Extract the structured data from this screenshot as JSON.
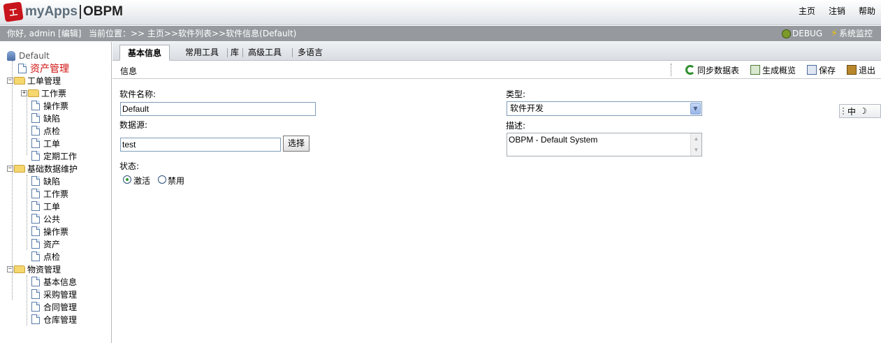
{
  "header": {
    "logo_mark": "工",
    "logo_apps": "myApps",
    "logo_product": "OBPM",
    "links": [
      "主页",
      "注销",
      "帮助"
    ]
  },
  "infobar": {
    "greeting": "你好, admin [编辑]",
    "location": "当前位置：>> 主页>>软件列表>>软件信息(Default)",
    "debug": "DEBUG",
    "monitor": "系统监控"
  },
  "tree": {
    "root": "Default",
    "asset_mgmt": "资产管理",
    "work_order_mgmt": "工单管理",
    "work_order_children": [
      "工作票",
      "操作票",
      "缺陷",
      "点检",
      "工单",
      "定期工作"
    ],
    "basic_data": "基础数据维护",
    "basic_data_children": [
      "缺陷",
      "工作票",
      "工单",
      "公共",
      "操作票",
      "资产",
      "点检"
    ],
    "material_mgmt": "物资管理",
    "material_children": [
      "基本信息",
      "采购管理",
      "合同管理",
      "仓库管理"
    ]
  },
  "tabs": [
    "基本信息",
    "常用工具",
    "库",
    "高级工具",
    "多语言"
  ],
  "toolbar": {
    "info": "信息",
    "sync": "同步数据表",
    "generate": "生成概览",
    "save": "保存",
    "exit": "退出"
  },
  "form": {
    "name_label": "软件名称:",
    "name_value": "Default",
    "datasource_label": "数据源:",
    "datasource_value": "test",
    "select_button": "选择",
    "status_label": "状态:",
    "status_active": "激活",
    "status_disabled": "禁用",
    "status_selected": "激活",
    "type_label": "类型:",
    "type_value": "软件开发",
    "desc_label": "描述:",
    "desc_value": "OBPM - Default System"
  },
  "ime": {
    "mode": "中",
    "moon": "☽"
  }
}
